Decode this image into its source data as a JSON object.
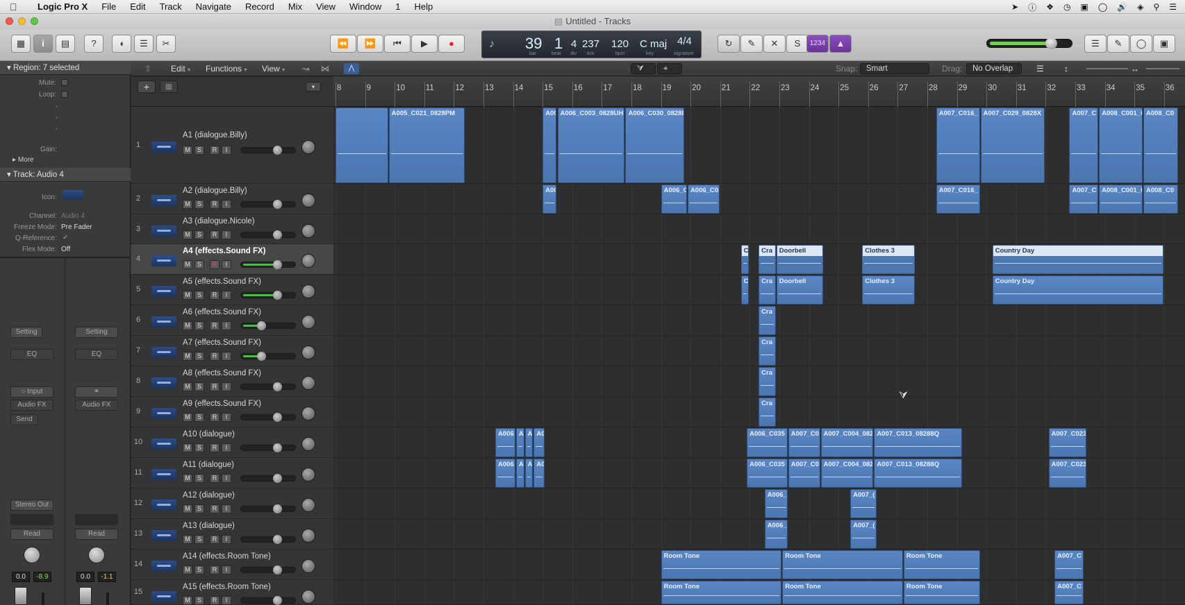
{
  "menubar": {
    "app": "Logic Pro X",
    "items": [
      "File",
      "Edit",
      "Track",
      "Navigate",
      "Record",
      "Mix",
      "View",
      "Window",
      "1",
      "Help"
    ]
  },
  "window": {
    "title": "Untitled - Tracks"
  },
  "lcd": {
    "bar": "39",
    "beat": "1",
    "div": "4",
    "tick": "237",
    "bpm": "120",
    "key": "C maj",
    "signature": "4/4",
    "sub_bar": "bar",
    "sub_beat": "beat",
    "sub_div": "div",
    "sub_tick": "tick",
    "sub_bpm": "bpm",
    "sub_key": "key",
    "sub_sig": "signature"
  },
  "controlbar": {
    "cycle_count": "1234"
  },
  "inspector": {
    "region_header": "Region: 7 selected",
    "region_fields": [
      "Mute:",
      "Loop:",
      "-",
      "-",
      "-",
      "Gain:"
    ],
    "more": "More",
    "track_header": "Track: Audio 4",
    "icon_label": "Icon:",
    "channel_label": "Channel:",
    "channel_value": "Audio 4",
    "freeze_label": "Freeze Mode:",
    "freeze_value": "Pre Fader",
    "qref_label": "Q-Reference:",
    "qref_value": "✓",
    "flex_label": "Flex Mode:",
    "flex_value": "Off",
    "strip1": {
      "setting": "Setting",
      "eq": "EQ",
      "input": "Input",
      "audio_fx": "Audio FX",
      "send": "Send",
      "output": "Stereo Out",
      "automation": "Read",
      "pan": "0.0",
      "level": "-8.9"
    },
    "strip2": {
      "setting": "Setting",
      "eq": "EQ",
      "audio_fx": "Audio FX",
      "automation": "Read",
      "pan": "0.0",
      "level": "-1.1"
    }
  },
  "toolbar": {
    "edit": "Edit",
    "functions": "Functions",
    "view": "View",
    "snap_label": "Snap:",
    "snap_value": "Smart",
    "drag_label": "Drag:",
    "drag_value": "No Overlap"
  },
  "ruler": {
    "bars": [
      "8",
      "9",
      "10",
      "11",
      "12",
      "13",
      "14",
      "15",
      "16",
      "17",
      "18",
      "19",
      "20",
      "21",
      "22",
      "23",
      "24",
      "25",
      "26",
      "27",
      "28",
      "29",
      "30",
      "31",
      "32",
      "33",
      "34",
      "35",
      "36"
    ]
  },
  "tracks": [
    {
      "num": "1",
      "name": "A1 (dialogue.Billy)",
      "volume": 0.7,
      "record": false
    },
    {
      "num": "2",
      "name": "A2 (dialogue.Billy)",
      "volume": 0.7,
      "record": false
    },
    {
      "num": "3",
      "name": "A3 (dialogue.Nicole)",
      "volume": 0.7,
      "record": false
    },
    {
      "num": "4",
      "name": "A4 (effects.Sound FX)",
      "volume": 0.7,
      "record": true,
      "selected": true
    },
    {
      "num": "5",
      "name": "A5 (effects.Sound FX)",
      "volume": 0.7,
      "record": false
    },
    {
      "num": "6",
      "name": "A6 (effects.Sound FX)",
      "volume": 0.35,
      "record": false
    },
    {
      "num": "7",
      "name": "A7 (effects.Sound FX)",
      "volume": 0.35,
      "record": false
    },
    {
      "num": "8",
      "name": "A8 (effects.Sound FX)",
      "volume": 0.7,
      "record": false
    },
    {
      "num": "9",
      "name": "A9 (effects.Sound FX)",
      "volume": 0.7,
      "record": false
    },
    {
      "num": "10",
      "name": "A10 (dialogue)",
      "volume": 0.7,
      "record": false
    },
    {
      "num": "11",
      "name": "A11 (dialogue)",
      "volume": 0.7,
      "record": false
    },
    {
      "num": "12",
      "name": "A12 (dialogue)",
      "volume": 0.7,
      "record": false
    },
    {
      "num": "13",
      "name": "A13 (dialogue)",
      "volume": 0.7,
      "record": false
    },
    {
      "num": "14",
      "name": "A14 (effects.Room Tone)",
      "volume": 0.7,
      "record": false
    },
    {
      "num": "15",
      "name": "A15 (effects.Room Tone)",
      "volume": 0.7,
      "record": false
    }
  ],
  "track_buttons": {
    "mute": "M",
    "solo": "S",
    "record": "R",
    "input": "I"
  },
  "regions": [
    {
      "track": 0,
      "start": 0,
      "end": 1.8,
      "label": ""
    },
    {
      "track": 0,
      "start": 1.8,
      "end": 4.4,
      "label": "A005_C021_0828PM"
    },
    {
      "track": 0,
      "start": 7,
      "end": 7.5,
      "label": "A00"
    },
    {
      "track": 0,
      "start": 7.5,
      "end": 9.8,
      "label": "A006_C003_0828UH"
    },
    {
      "track": 0,
      "start": 9.8,
      "end": 11.8,
      "label": "A006_C030_0828I"
    },
    {
      "track": 0,
      "start": 20.3,
      "end": 21.8,
      "label": "A007_C016_"
    },
    {
      "track": 0,
      "start": 21.8,
      "end": 24,
      "label": "A007_C029_0828X"
    },
    {
      "track": 0,
      "start": 24.8,
      "end": 25.8,
      "label": "A007_C"
    },
    {
      "track": 0,
      "start": 25.8,
      "end": 27.3,
      "label": "A008_C001_082"
    },
    {
      "track": 0,
      "start": 27.3,
      "end": 28.5,
      "label": "A008_C0"
    },
    {
      "track": 1,
      "start": 7,
      "end": 7.5,
      "label": "A00"
    },
    {
      "track": 1,
      "start": 11,
      "end": 11.9,
      "label": "A006_C"
    },
    {
      "track": 1,
      "start": 11.9,
      "end": 13,
      "label": "A006_C02"
    },
    {
      "track": 1,
      "start": 20.3,
      "end": 21.8,
      "label": "A007_C016_"
    },
    {
      "track": 1,
      "start": 24.8,
      "end": 25.8,
      "label": "A007_C"
    },
    {
      "track": 1,
      "start": 25.8,
      "end": 27.3,
      "label": "A008_C001_082"
    },
    {
      "track": 1,
      "start": 27.3,
      "end": 28.5,
      "label": "A008_C0"
    },
    {
      "track": 3,
      "start": 13.7,
      "end": 14,
      "label": "C",
      "light": true
    },
    {
      "track": 3,
      "start": 14.3,
      "end": 14.9,
      "label": "Cra",
      "light": true
    },
    {
      "track": 3,
      "start": 14.9,
      "end": 16.5,
      "label": "Doorbell",
      "light": true
    },
    {
      "track": 3,
      "start": 17.8,
      "end": 19.6,
      "label": "Clothes 3",
      "light": true
    },
    {
      "track": 3,
      "start": 22.2,
      "end": 28,
      "label": "Country Day",
      "light": true
    },
    {
      "track": 4,
      "start": 13.7,
      "end": 14,
      "label": "C"
    },
    {
      "track": 4,
      "start": 14.3,
      "end": 14.9,
      "label": "Cra"
    },
    {
      "track": 4,
      "start": 14.9,
      "end": 16.5,
      "label": "Doorbell"
    },
    {
      "track": 4,
      "start": 17.8,
      "end": 19.6,
      "label": "Clothes 3"
    },
    {
      "track": 4,
      "start": 22.2,
      "end": 28,
      "label": "Country Day"
    },
    {
      "track": 5,
      "start": 14.3,
      "end": 14.9,
      "label": "Cra"
    },
    {
      "track": 6,
      "start": 14.3,
      "end": 14.9,
      "label": "Cra"
    },
    {
      "track": 7,
      "start": 14.3,
      "end": 14.9,
      "label": "Cra"
    },
    {
      "track": 8,
      "start": 14.3,
      "end": 14.9,
      "label": "Cra"
    },
    {
      "track": 9,
      "start": 5.4,
      "end": 6.1,
      "label": "A006"
    },
    {
      "track": 9,
      "start": 6.1,
      "end": 6.4,
      "label": "A("
    },
    {
      "track": 9,
      "start": 6.4,
      "end": 6.7,
      "label": "A("
    },
    {
      "track": 9,
      "start": 6.7,
      "end": 7.1,
      "label": "A0"
    },
    {
      "track": 9,
      "start": 13.9,
      "end": 15.3,
      "label": "A006_C035"
    },
    {
      "track": 9,
      "start": 15.3,
      "end": 16.4,
      "label": "A007_C0"
    },
    {
      "track": 9,
      "start": 16.4,
      "end": 18.2,
      "label": "A007_C004_082"
    },
    {
      "track": 9,
      "start": 18.2,
      "end": 21.2,
      "label": "A007_C013_08288Q"
    },
    {
      "track": 9,
      "start": 24.1,
      "end": 25.4,
      "label": "A007_C023"
    },
    {
      "track": 10,
      "start": 5.4,
      "end": 6.1,
      "label": "A006"
    },
    {
      "track": 10,
      "start": 6.1,
      "end": 6.4,
      "label": "A("
    },
    {
      "track": 10,
      "start": 6.4,
      "end": 6.7,
      "label": "A("
    },
    {
      "track": 10,
      "start": 6.7,
      "end": 7.1,
      "label": "A0"
    },
    {
      "track": 10,
      "start": 13.9,
      "end": 15.3,
      "label": "A006_C035"
    },
    {
      "track": 10,
      "start": 15.3,
      "end": 16.4,
      "label": "A007_C0"
    },
    {
      "track": 10,
      "start": 16.4,
      "end": 18.2,
      "label": "A007_C004_082"
    },
    {
      "track": 10,
      "start": 18.2,
      "end": 21.2,
      "label": "A007_C013_08288Q"
    },
    {
      "track": 10,
      "start": 24.1,
      "end": 25.4,
      "label": "A007_C023"
    },
    {
      "track": 11,
      "start": 14.5,
      "end": 15.3,
      "label": "A006_("
    },
    {
      "track": 11,
      "start": 17.4,
      "end": 18.3,
      "label": "A007_("
    },
    {
      "track": 12,
      "start": 14.5,
      "end": 15.3,
      "label": "A006_("
    },
    {
      "track": 12,
      "start": 17.4,
      "end": 18.3,
      "label": "A007_("
    },
    {
      "track": 13,
      "start": 11,
      "end": 15.1,
      "label": "Room Tone"
    },
    {
      "track": 13,
      "start": 15.1,
      "end": 19.2,
      "label": "Room Tone"
    },
    {
      "track": 13,
      "start": 19.2,
      "end": 21.8,
      "label": "Room Tone"
    },
    {
      "track": 13,
      "start": 24.3,
      "end": 25.3,
      "label": "A007_C"
    },
    {
      "track": 14,
      "start": 11,
      "end": 15.1,
      "label": "Room Tone"
    },
    {
      "track": 14,
      "start": 15.1,
      "end": 19.2,
      "label": "Room Tone"
    },
    {
      "track": 14,
      "start": 19.2,
      "end": 21.8,
      "label": "Room Tone"
    },
    {
      "track": 14,
      "start": 24.3,
      "end": 25.3,
      "label": "A007_C"
    }
  ]
}
